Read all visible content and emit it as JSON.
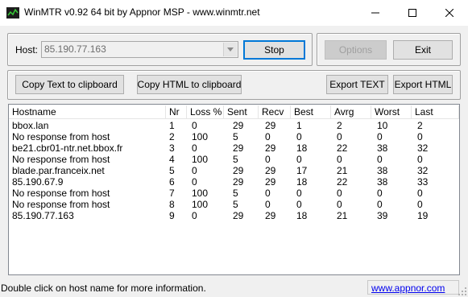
{
  "window": {
    "title": "WinMTR v0.92 64 bit by Appnor MSP - www.winmtr.net"
  },
  "controls": {
    "host_label": "Host:",
    "host_value": "85.190.77.163",
    "stop_label": "Stop",
    "options_label": "Options",
    "exit_label": "Exit",
    "copy_text_label": "Copy Text to clipboard",
    "copy_html_label": "Copy HTML to clipboard",
    "export_text_label": "Export TEXT",
    "export_html_label": "Export HTML"
  },
  "table": {
    "columns": [
      "Hostname",
      "Nr",
      "Loss %",
      "Sent",
      "Recv",
      "Best",
      "Avrg",
      "Worst",
      "Last"
    ],
    "rows": [
      [
        "bbox.lan",
        "1",
        "0",
        "29",
        "29",
        "1",
        "2",
        "10",
        "2"
      ],
      [
        "No response from host",
        "2",
        "100",
        "5",
        "0",
        "0",
        "0",
        "0",
        "0"
      ],
      [
        "be21.cbr01-ntr.net.bbox.fr",
        "3",
        "0",
        "29",
        "29",
        "18",
        "22",
        "38",
        "32"
      ],
      [
        "No response from host",
        "4",
        "100",
        "5",
        "0",
        "0",
        "0",
        "0",
        "0"
      ],
      [
        "blade.par.franceix.net",
        "5",
        "0",
        "29",
        "29",
        "17",
        "21",
        "38",
        "32"
      ],
      [
        "85.190.67.9",
        "6",
        "0",
        "29",
        "29",
        "18",
        "22",
        "38",
        "33"
      ],
      [
        "No response from host",
        "7",
        "100",
        "5",
        "0",
        "0",
        "0",
        "0",
        "0"
      ],
      [
        "No response from host",
        "8",
        "100",
        "5",
        "0",
        "0",
        "0",
        "0",
        "0"
      ],
      [
        "85.190.77.163",
        "9",
        "0",
        "29",
        "29",
        "18",
        "21",
        "39",
        "19"
      ]
    ]
  },
  "status": {
    "message": "Double click on host name for more information.",
    "link": "www.appnor.com"
  }
}
